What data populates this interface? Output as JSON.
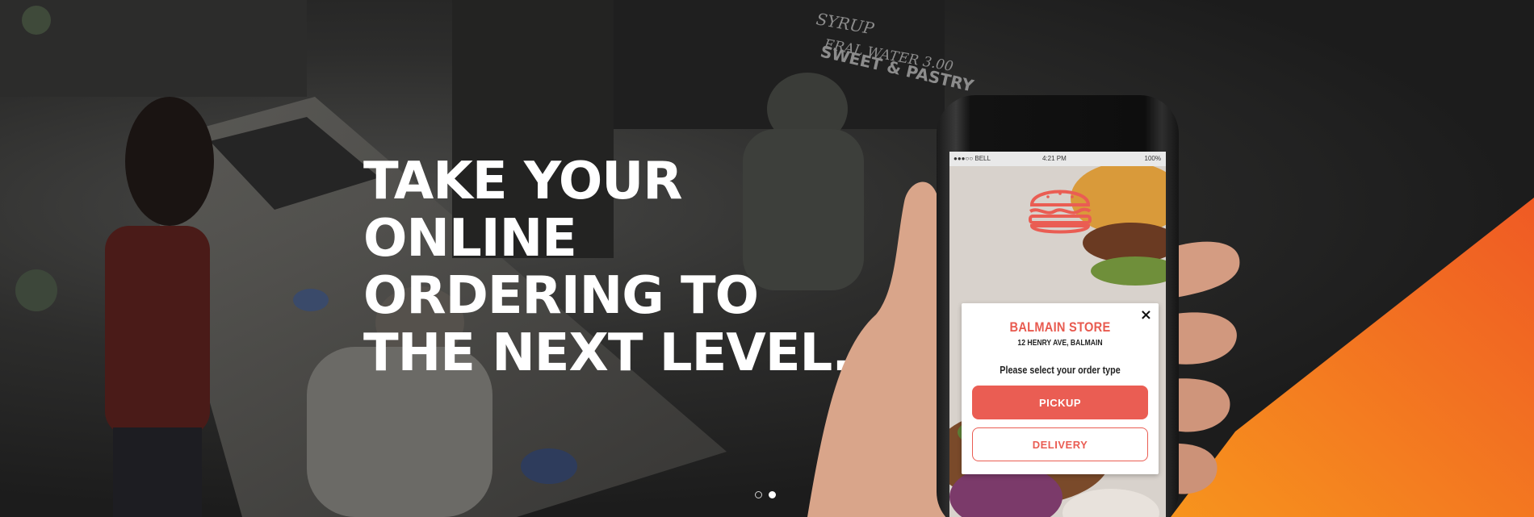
{
  "hero": {
    "headline_lines": [
      "TAKE YOUR",
      "ONLINE",
      "ORDERING TO",
      "THE NEXT LEVEL."
    ]
  },
  "phone": {
    "status": {
      "carrier": "●●●○○ BELL",
      "time": "4:21 PM",
      "battery": "100%"
    },
    "modal": {
      "close": "×",
      "store_name": "BALMAIN STORE",
      "store_address": "12 HENRY AVE, BALMAIN",
      "prompt": "Please select your order type",
      "pickup_label": "PICKUP",
      "delivery_label": "DELIVERY"
    }
  },
  "carousel": {
    "slide_count": 2,
    "active_index": 1
  },
  "colors": {
    "accent_orange": "#f26a21",
    "brand_red": "#ea5d53",
    "background_dark": "#1b1b1b"
  },
  "icons": [
    "burger-icon",
    "close-icon"
  ]
}
